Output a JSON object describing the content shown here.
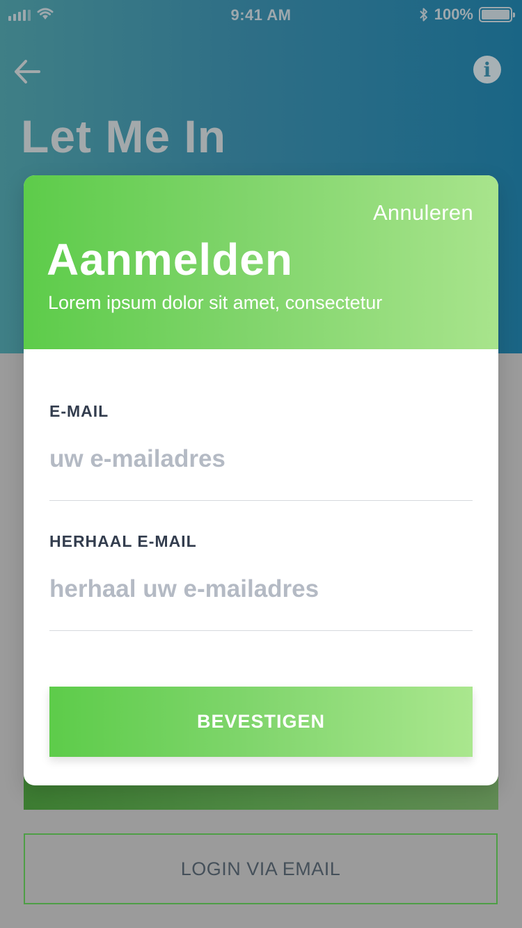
{
  "status_bar": {
    "time": "9:41 AM",
    "battery": "100%"
  },
  "background": {
    "title": "Let Me In",
    "login_email_label": "LOGIN VIA EMAIL"
  },
  "modal": {
    "cancel_label": "Annuleren",
    "title": "Aanmelden",
    "subtitle": "Lorem ipsum dolor sit amet, consectetur",
    "email": {
      "label": "E-MAIL",
      "placeholder": "uw e-mailadres",
      "value": ""
    },
    "repeat_email": {
      "label": "HERHAAL E-MAIL",
      "placeholder": "herhaal uw e-mailadres",
      "value": ""
    },
    "confirm_label": "BEVESTIGEN"
  },
  "colors": {
    "accent_green": "#5dcc4a",
    "accent_green_light": "#a8e48c",
    "hero_blue": "#1a6585",
    "text_dark": "#333d4e",
    "placeholder": "#b4bac4"
  },
  "icons": {
    "back": "arrow-left-icon",
    "info": "info-icon",
    "signal": "signal-icon",
    "wifi": "wifi-icon",
    "bluetooth": "bluetooth-icon",
    "battery": "battery-icon"
  }
}
